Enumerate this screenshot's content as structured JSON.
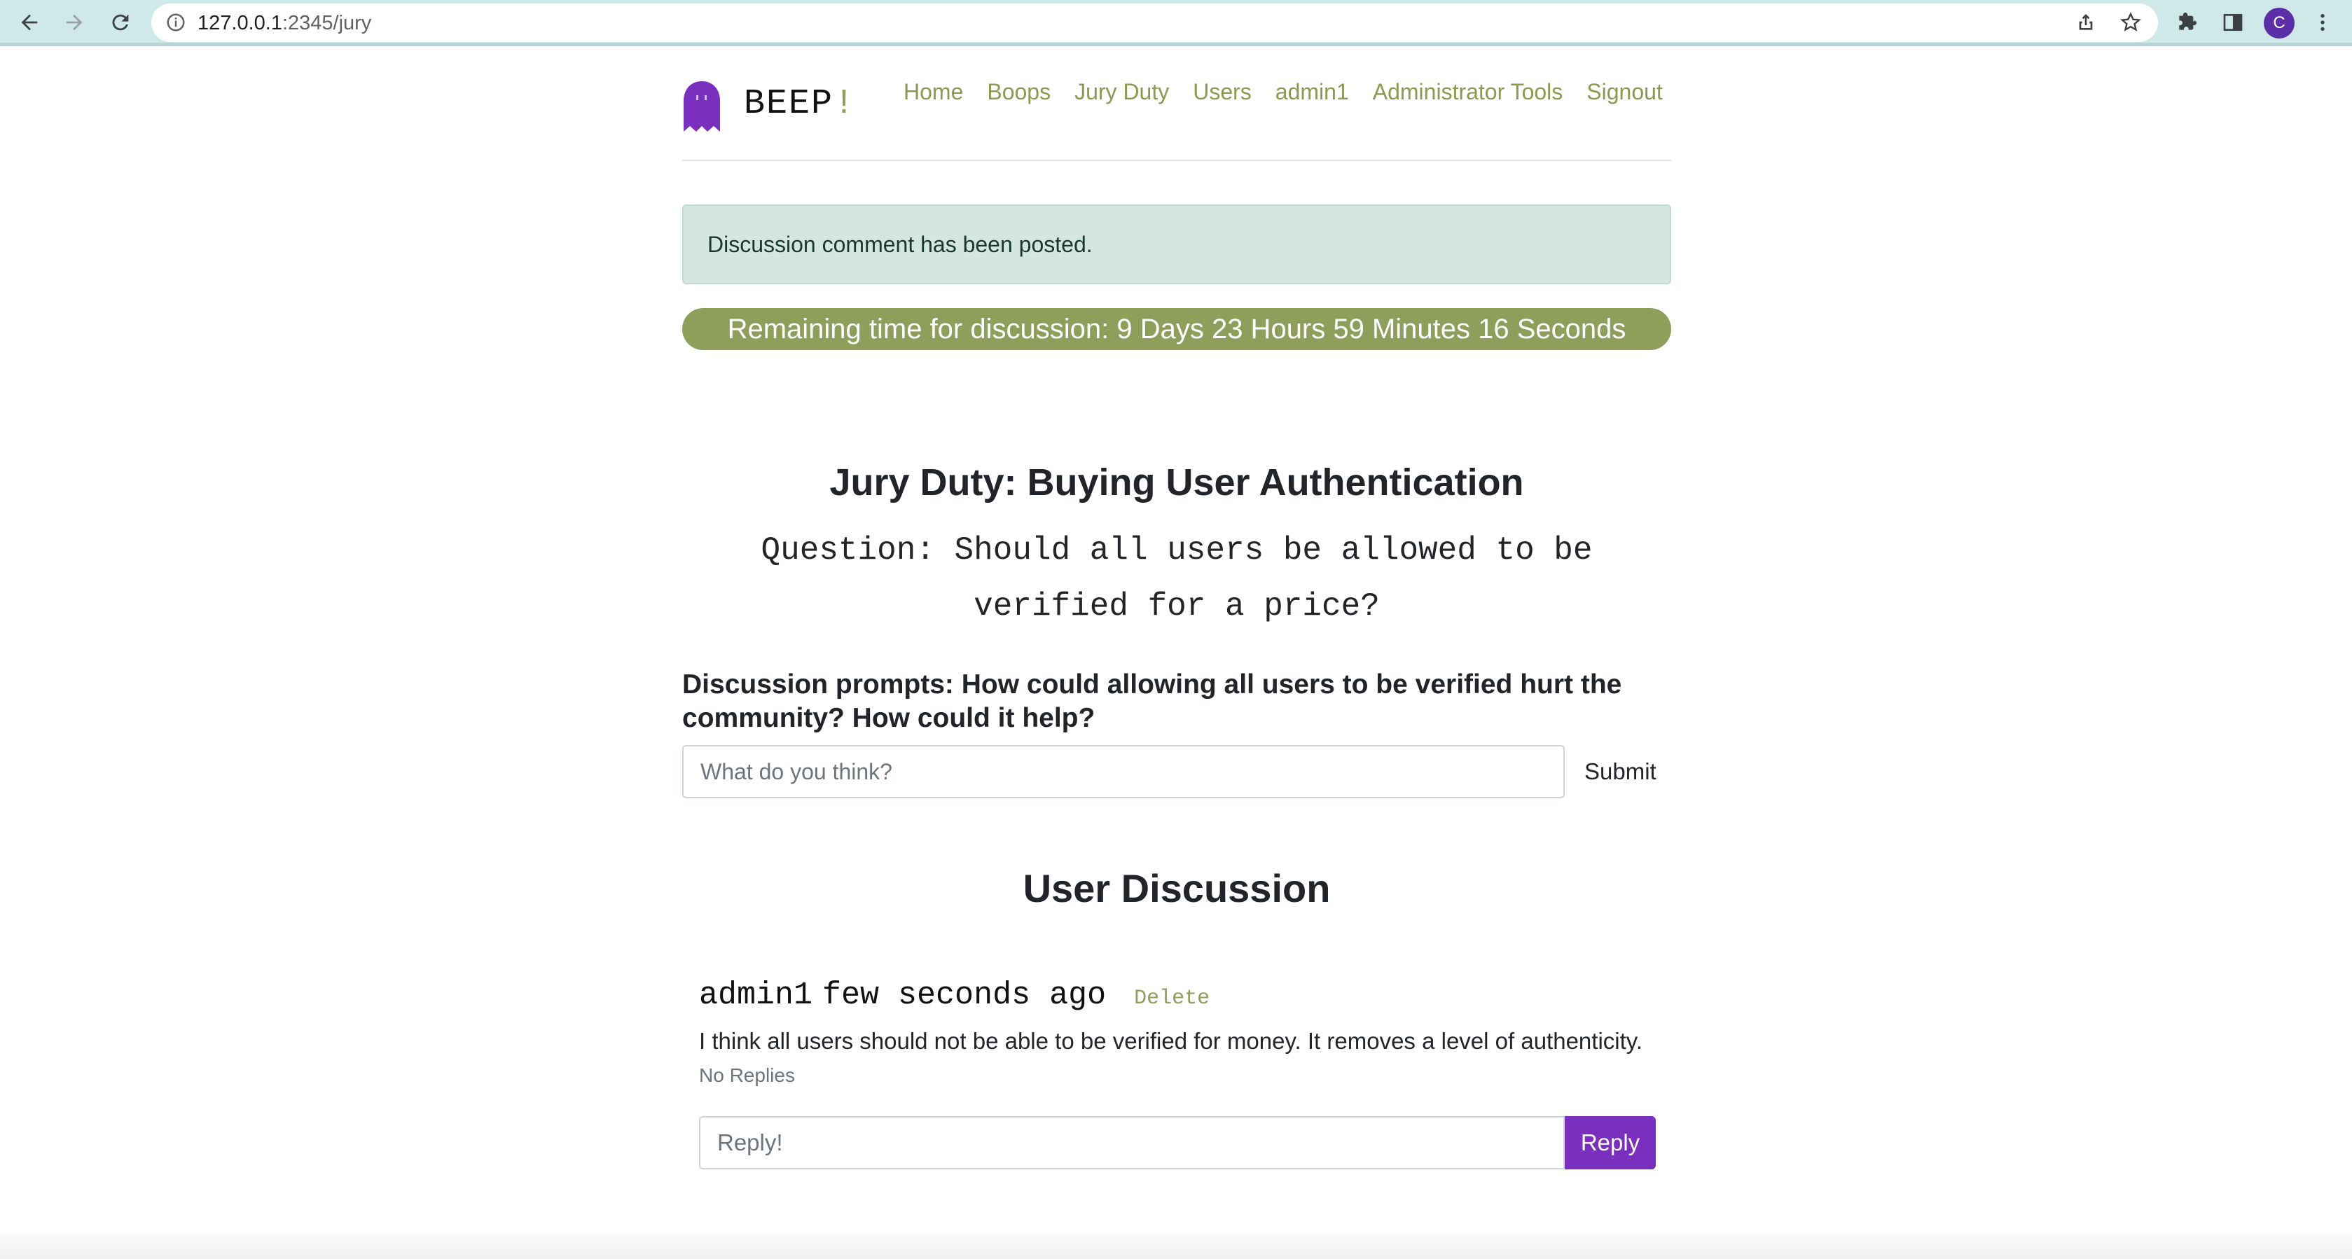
{
  "browser": {
    "url_host": "127.0.0.1",
    "url_path": ":2345/jury",
    "profile_initial": "C"
  },
  "site": {
    "brand_text": "BEEP",
    "brand_bang": "!",
    "nav": [
      "Home",
      "Boops",
      "Jury Duty",
      "Users",
      "admin1",
      "Administrator Tools",
      "Signout"
    ]
  },
  "alert": {
    "message": "Discussion comment has been posted."
  },
  "timer": {
    "text": "Remaining time for discussion: 9 Days 23 Hours 59 Minutes 16 Seconds"
  },
  "jury": {
    "title": "Jury Duty: Buying User Authentication",
    "question": "Question: Should all users be allowed to be verified for a price?",
    "prompts": "Discussion prompts: How could allowing all users to be verified hurt the community? How could it help?",
    "input_placeholder": "What do you think?",
    "submit_label": "Submit"
  },
  "discussion": {
    "title": "User Discussion",
    "comments": [
      {
        "author": "admin1",
        "time": "few seconds ago",
        "delete_label": "Delete",
        "text": "I think all users should not be able to be verified for money. It removes a level of authenticity.",
        "replies_text": "No Replies",
        "reply_placeholder": "Reply!",
        "reply_label": "Reply"
      }
    ]
  },
  "colors": {
    "accent_olive": "#8f9e5b",
    "accent_purple": "#7b2fbf",
    "alert_bg": "#d4e6df",
    "chrome_bg": "#cfe9e9"
  }
}
